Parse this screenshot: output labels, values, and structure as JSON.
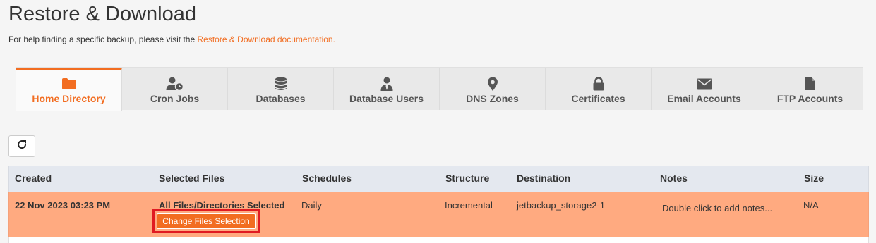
{
  "header": {
    "title": "Restore & Download",
    "help_prefix": "For help finding a specific backup, please visit the ",
    "help_link": "Restore & Download documentation."
  },
  "tabs": [
    {
      "label": "Home Directory",
      "icon": "folder-icon",
      "active": true
    },
    {
      "label": "Cron Jobs",
      "icon": "user-clock-icon",
      "active": false
    },
    {
      "label": "Databases",
      "icon": "database-icon",
      "active": false
    },
    {
      "label": "Database Users",
      "icon": "user-tie-icon",
      "active": false
    },
    {
      "label": "DNS Zones",
      "icon": "map-marker-icon",
      "active": false
    },
    {
      "label": "Certificates",
      "icon": "lock-icon",
      "active": false
    },
    {
      "label": "Email Accounts",
      "icon": "envelope-icon",
      "active": false
    },
    {
      "label": "FTP Accounts",
      "icon": "file-icon",
      "active": false
    }
  ],
  "toolbar": {
    "refresh_icon": "refresh-icon"
  },
  "table": {
    "columns": [
      "Created",
      "Selected Files",
      "Schedules",
      "Structure",
      "Destination",
      "Notes",
      "Size"
    ],
    "rows": [
      {
        "created": "22 Nov 2023 03:23 PM",
        "selected_files": "All Files/Directories Selected",
        "change_button": "Change Files Selection",
        "schedules": "Daily",
        "structure": "Incremental",
        "destination": "jetbackup_storage2-1",
        "notes": "Double click to add notes...",
        "size": "N/A"
      }
    ]
  },
  "colors": {
    "accent": "#f26d21",
    "selected_row": "#ffaa80",
    "highlight_frame": "#e01b22",
    "table_header": "#e4e8ef"
  }
}
